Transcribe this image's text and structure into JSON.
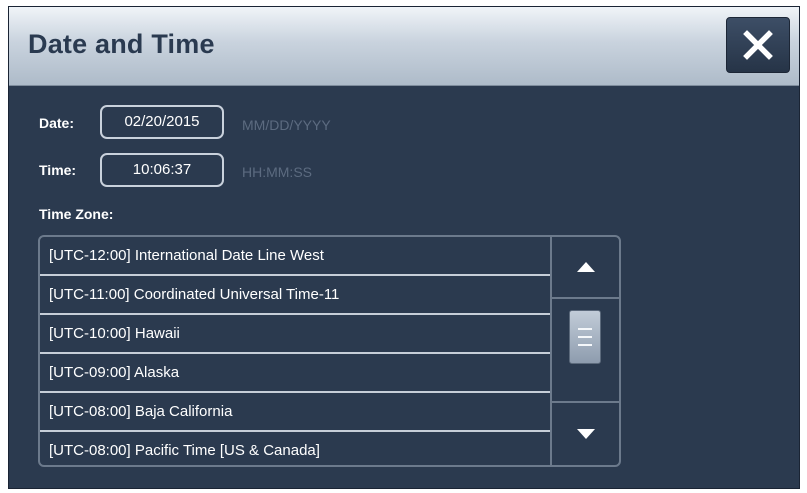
{
  "dialog": {
    "title": "Date and Time",
    "close_icon": "close-icon"
  },
  "date": {
    "label": "Date:",
    "value": "02/20/2015",
    "format_hint": "MM/DD/YYYY"
  },
  "time": {
    "label": "Time:",
    "value": "10:06:37",
    "format_hint": "HH:MM:SS"
  },
  "timezone": {
    "label": "Time Zone:",
    "items": [
      "[UTC-12:00] International Date Line West",
      "[UTC-11:00] Coordinated Universal Time-11",
      "[UTC-10:00] Hawaii",
      "[UTC-09:00] Alaska",
      "[UTC-08:00] Baja California",
      "[UTC-08:00] Pacific Time [US & Canada]"
    ],
    "scroll": {
      "up_icon": "chevron-up-icon",
      "down_icon": "chevron-down-icon",
      "thumb_icon": "grip-icon"
    }
  },
  "colors": {
    "background": "#2b3a4f",
    "title_text": "#2a3a50",
    "hint_text": "#5c6b80",
    "border": "#c6ced8"
  }
}
